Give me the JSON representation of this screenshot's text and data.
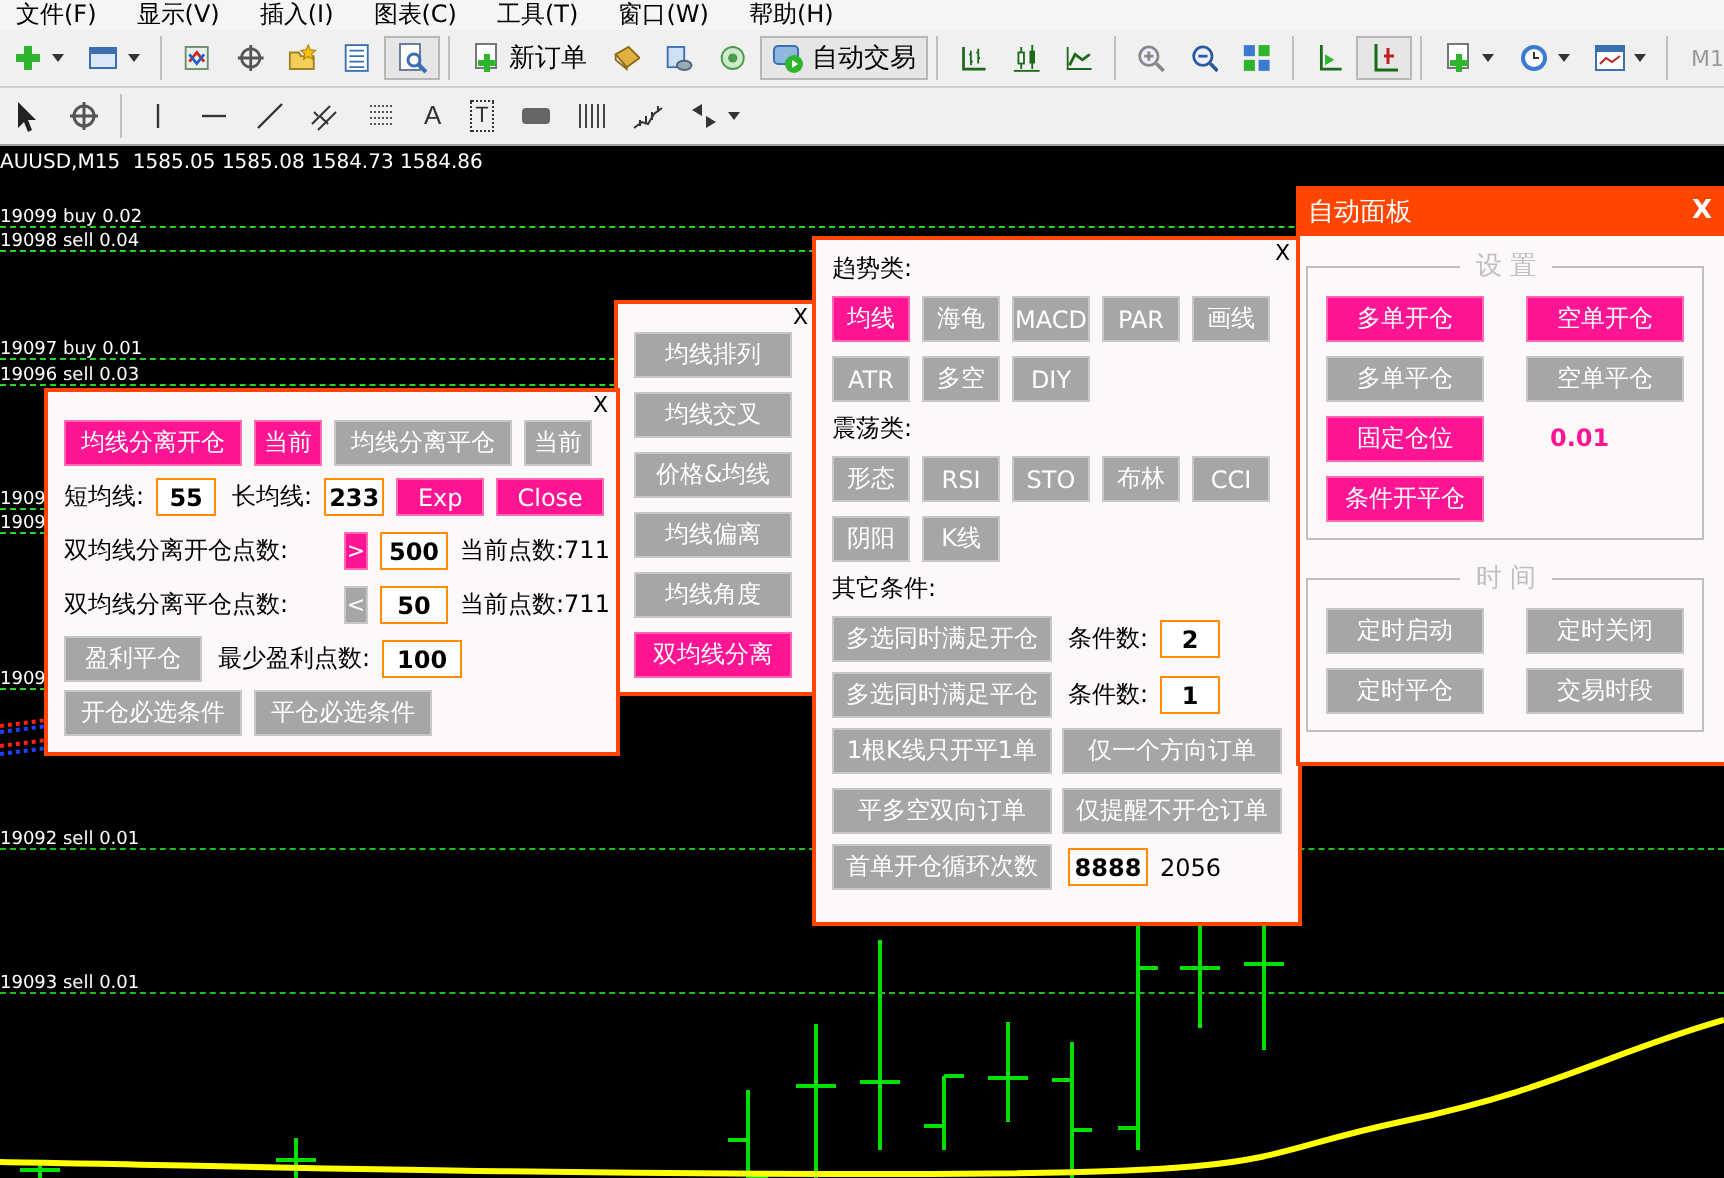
{
  "menu": [
    {
      "label": "文件(F)"
    },
    {
      "label": "显示(V)"
    },
    {
      "label": "插入(I)"
    },
    {
      "label": "图表(C)"
    },
    {
      "label": "工具(T)"
    },
    {
      "label": "窗口(W)"
    },
    {
      "label": "帮助(H)"
    }
  ],
  "toolbar": {
    "new_order": "新订单",
    "auto_trading": "自动交易",
    "timeframe": "M1"
  },
  "drawing_tools": {
    "text_tool": "A",
    "label_tool": "T"
  },
  "chart": {
    "header": "AUUSD,M15  1585.05 1585.08 1584.73 1584.86",
    "order_lines": [
      {
        "label": "19099 buy 0.02"
      },
      {
        "label": "19098 sell 0.04"
      },
      {
        "label": "19097 buy 0.01"
      },
      {
        "label": "19096 sell 0.03"
      },
      {
        "label": "1909"
      },
      {
        "label": "1909"
      },
      {
        "label": "1909"
      },
      {
        "label": "19092 sell 0.01"
      },
      {
        "label": "19093 sell 0.01"
      }
    ]
  },
  "ma_type_panel": {
    "close": "X",
    "items": [
      {
        "label": "均线排列",
        "selected": false
      },
      {
        "label": "均线交叉",
        "selected": false
      },
      {
        "label": "价格&均线",
        "selected": false
      },
      {
        "label": "均线偏离",
        "selected": false
      },
      {
        "label": "均线角度",
        "selected": false
      },
      {
        "label": "双均线分离",
        "selected": true
      }
    ]
  },
  "ma_panel": {
    "close": "X",
    "top_buttons": [
      {
        "label": "均线分离开仓",
        "on": true,
        "kind": "wide"
      },
      {
        "label": "当前",
        "on": true,
        "kind": "narrow"
      },
      {
        "label": "均线分离平仓",
        "on": false,
        "kind": "wide"
      },
      {
        "label": "当前",
        "on": false,
        "kind": "narrow"
      }
    ],
    "short_label": "短均线:",
    "short_value": "55",
    "long_label": "长均线:",
    "long_value": "233",
    "exp_button": {
      "label": "Exp",
      "on": true
    },
    "close_all_button": {
      "label": "Close",
      "on": true
    },
    "points": [
      {
        "label": "双均线分离开仓点数:",
        "operator": ">",
        "on": true,
        "value": "500",
        "current": "当前点数:711"
      },
      {
        "label": "双均线分离平仓点数:",
        "operator": "<",
        "on": false,
        "value": "50",
        "current": "当前点数:711"
      }
    ],
    "profit_close": {
      "label": "盈利平仓",
      "on": false
    },
    "min_profit_label": "最少盈利点数:",
    "min_profit_value": "100",
    "required_buttons": [
      {
        "label": "开仓必选条件",
        "on": false
      },
      {
        "label": "平仓必选条件",
        "on": false
      }
    ]
  },
  "condition_panel": {
    "close": "X",
    "trend_title": "趋势类:",
    "trend": [
      {
        "label": "均线",
        "selected": true
      },
      {
        "label": "海龟",
        "selected": false
      },
      {
        "label": "MACD",
        "selected": false
      },
      {
        "label": "PAR",
        "selected": false
      },
      {
        "label": "画线",
        "selected": false
      },
      {
        "label": "ATR",
        "selected": false
      },
      {
        "label": "多空",
        "selected": false
      },
      {
        "label": "DIY",
        "selected": false
      }
    ],
    "oscillator_title": "震荡类:",
    "oscillator": [
      {
        "label": "形态",
        "selected": false
      },
      {
        "label": "RSI",
        "selected": false
      },
      {
        "label": "STO",
        "selected": false
      },
      {
        "label": "布林",
        "selected": false
      },
      {
        "label": "CCI",
        "selected": false
      },
      {
        "label": "阴阳",
        "selected": false
      },
      {
        "label": "K线",
        "selected": false
      }
    ],
    "other_title": "其它条件:",
    "multi": [
      {
        "label": "多选同时满足开仓",
        "on": false,
        "count_label": "条件数:",
        "count": "2"
      },
      {
        "label": "多选同时满足平仓",
        "on": false,
        "count_label": "条件数:",
        "count": "1"
      }
    ],
    "options": [
      {
        "label": "1根K线只开平1单",
        "on": false
      },
      {
        "label": "仅一个方向订单",
        "on": false
      },
      {
        "label": "平多空双向订单",
        "on": false
      },
      {
        "label": "仅提醒不开仓订单",
        "on": false
      }
    ],
    "loop": {
      "label": "首单开仓循环次数",
      "on": false,
      "value": "8888",
      "count": "2056"
    }
  },
  "auto_panel": {
    "title": "自动面板",
    "close": "X",
    "settings_legend": "设 置",
    "settings": [
      {
        "kind": "button",
        "label": "多单开仓",
        "on": true
      },
      {
        "kind": "button",
        "label": "空单开仓",
        "on": true
      },
      {
        "kind": "button",
        "label": "多单平仓",
        "on": false
      },
      {
        "kind": "button",
        "label": "空单平仓",
        "on": false
      },
      {
        "kind": "button",
        "label": "固定仓位",
        "on": true
      },
      {
        "kind": "value",
        "label": "0.01"
      },
      {
        "kind": "button",
        "label": "条件开平仓",
        "on": true
      }
    ],
    "time_legend": "时 间",
    "time": [
      {
        "label": "定时启动",
        "on": false
      },
      {
        "label": "定时关闭",
        "on": false
      },
      {
        "label": "定时平仓",
        "on": false
      },
      {
        "label": "交易时段",
        "on": false
      }
    ]
  }
}
